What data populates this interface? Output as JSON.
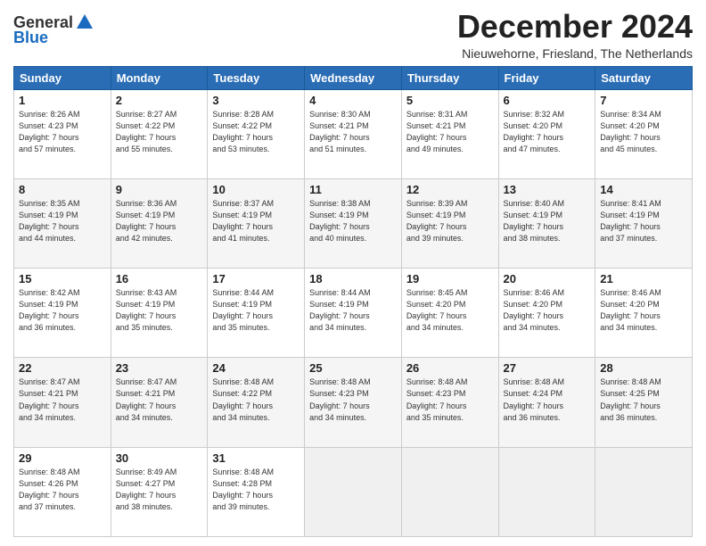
{
  "logo": {
    "general": "General",
    "blue": "Blue"
  },
  "title": "December 2024",
  "subtitle": "Nieuwehorne, Friesland, The Netherlands",
  "days_header": [
    "Sunday",
    "Monday",
    "Tuesday",
    "Wednesday",
    "Thursday",
    "Friday",
    "Saturday"
  ],
  "weeks": [
    [
      {
        "day": "1",
        "info": "Sunrise: 8:26 AM\nSunset: 4:23 PM\nDaylight: 7 hours\nand 57 minutes."
      },
      {
        "day": "2",
        "info": "Sunrise: 8:27 AM\nSunset: 4:22 PM\nDaylight: 7 hours\nand 55 minutes."
      },
      {
        "day": "3",
        "info": "Sunrise: 8:28 AM\nSunset: 4:22 PM\nDaylight: 7 hours\nand 53 minutes."
      },
      {
        "day": "4",
        "info": "Sunrise: 8:30 AM\nSunset: 4:21 PM\nDaylight: 7 hours\nand 51 minutes."
      },
      {
        "day": "5",
        "info": "Sunrise: 8:31 AM\nSunset: 4:21 PM\nDaylight: 7 hours\nand 49 minutes."
      },
      {
        "day": "6",
        "info": "Sunrise: 8:32 AM\nSunset: 4:20 PM\nDaylight: 7 hours\nand 47 minutes."
      },
      {
        "day": "7",
        "info": "Sunrise: 8:34 AM\nSunset: 4:20 PM\nDaylight: 7 hours\nand 45 minutes."
      }
    ],
    [
      {
        "day": "8",
        "info": "Sunrise: 8:35 AM\nSunset: 4:19 PM\nDaylight: 7 hours\nand 44 minutes."
      },
      {
        "day": "9",
        "info": "Sunrise: 8:36 AM\nSunset: 4:19 PM\nDaylight: 7 hours\nand 42 minutes."
      },
      {
        "day": "10",
        "info": "Sunrise: 8:37 AM\nSunset: 4:19 PM\nDaylight: 7 hours\nand 41 minutes."
      },
      {
        "day": "11",
        "info": "Sunrise: 8:38 AM\nSunset: 4:19 PM\nDaylight: 7 hours\nand 40 minutes."
      },
      {
        "day": "12",
        "info": "Sunrise: 8:39 AM\nSunset: 4:19 PM\nDaylight: 7 hours\nand 39 minutes."
      },
      {
        "day": "13",
        "info": "Sunrise: 8:40 AM\nSunset: 4:19 PM\nDaylight: 7 hours\nand 38 minutes."
      },
      {
        "day": "14",
        "info": "Sunrise: 8:41 AM\nSunset: 4:19 PM\nDaylight: 7 hours\nand 37 minutes."
      }
    ],
    [
      {
        "day": "15",
        "info": "Sunrise: 8:42 AM\nSunset: 4:19 PM\nDaylight: 7 hours\nand 36 minutes."
      },
      {
        "day": "16",
        "info": "Sunrise: 8:43 AM\nSunset: 4:19 PM\nDaylight: 7 hours\nand 35 minutes."
      },
      {
        "day": "17",
        "info": "Sunrise: 8:44 AM\nSunset: 4:19 PM\nDaylight: 7 hours\nand 35 minutes."
      },
      {
        "day": "18",
        "info": "Sunrise: 8:44 AM\nSunset: 4:19 PM\nDaylight: 7 hours\nand 34 minutes."
      },
      {
        "day": "19",
        "info": "Sunrise: 8:45 AM\nSunset: 4:20 PM\nDaylight: 7 hours\nand 34 minutes."
      },
      {
        "day": "20",
        "info": "Sunrise: 8:46 AM\nSunset: 4:20 PM\nDaylight: 7 hours\nand 34 minutes."
      },
      {
        "day": "21",
        "info": "Sunrise: 8:46 AM\nSunset: 4:20 PM\nDaylight: 7 hours\nand 34 minutes."
      }
    ],
    [
      {
        "day": "22",
        "info": "Sunrise: 8:47 AM\nSunset: 4:21 PM\nDaylight: 7 hours\nand 34 minutes."
      },
      {
        "day": "23",
        "info": "Sunrise: 8:47 AM\nSunset: 4:21 PM\nDaylight: 7 hours\nand 34 minutes."
      },
      {
        "day": "24",
        "info": "Sunrise: 8:48 AM\nSunset: 4:22 PM\nDaylight: 7 hours\nand 34 minutes."
      },
      {
        "day": "25",
        "info": "Sunrise: 8:48 AM\nSunset: 4:23 PM\nDaylight: 7 hours\nand 34 minutes."
      },
      {
        "day": "26",
        "info": "Sunrise: 8:48 AM\nSunset: 4:23 PM\nDaylight: 7 hours\nand 35 minutes."
      },
      {
        "day": "27",
        "info": "Sunrise: 8:48 AM\nSunset: 4:24 PM\nDaylight: 7 hours\nand 36 minutes."
      },
      {
        "day": "28",
        "info": "Sunrise: 8:48 AM\nSunset: 4:25 PM\nDaylight: 7 hours\nand 36 minutes."
      }
    ],
    [
      {
        "day": "29",
        "info": "Sunrise: 8:48 AM\nSunset: 4:26 PM\nDaylight: 7 hours\nand 37 minutes."
      },
      {
        "day": "30",
        "info": "Sunrise: 8:49 AM\nSunset: 4:27 PM\nDaylight: 7 hours\nand 38 minutes."
      },
      {
        "day": "31",
        "info": "Sunrise: 8:48 AM\nSunset: 4:28 PM\nDaylight: 7 hours\nand 39 minutes."
      },
      {
        "day": "",
        "info": ""
      },
      {
        "day": "",
        "info": ""
      },
      {
        "day": "",
        "info": ""
      },
      {
        "day": "",
        "info": ""
      }
    ]
  ]
}
